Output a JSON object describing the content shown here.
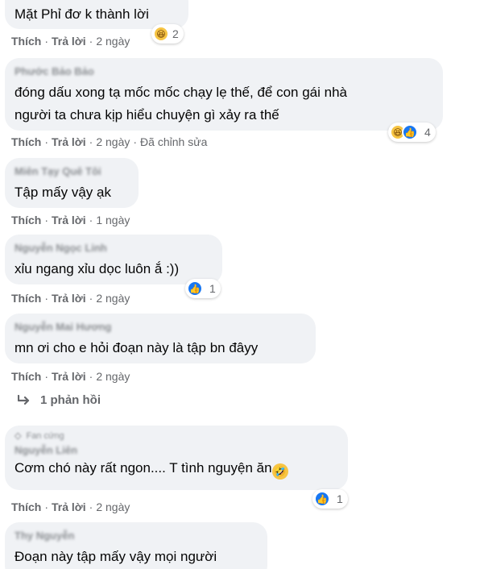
{
  "actions": {
    "like": "Thích",
    "reply": "Trả lời",
    "dot": "·"
  },
  "comments": [
    {
      "author": "",
      "text": "Mặt Phỉ đơ k thành lời",
      "time": "2 ngày",
      "edited": "",
      "reactions": {
        "icons": [
          "haha"
        ],
        "count": "2"
      }
    },
    {
      "author": "Phước Bảo Bảo",
      "text_line1": "đóng dấu xong tạ mốc mốc chạy lẹ thế, để con gái nhà",
      "text_line2": "người ta chưa kịp hiểu chuyện gì xảy ra thế",
      "time": "2 ngày",
      "edited": "Đã chỉnh sửa",
      "reactions": {
        "icons": [
          "haha",
          "like"
        ],
        "count": "4"
      }
    },
    {
      "author": "Miên Tạy Quê Tôi",
      "text": "Tập mấy vậy ạk",
      "time": "1 ngày"
    },
    {
      "author": "Nguyễn Ngọc Linh",
      "text": "xỉu ngang xỉu dọc luôn ắ :))",
      "time": "2 ngày",
      "reactions": {
        "icons": [
          "like"
        ],
        "count": "1"
      }
    },
    {
      "author": "Nguyễn Mai Hương",
      "text": "mn ơi cho e hỏi đoạn này là tập bn đâyy",
      "time": "2 ngày"
    },
    {
      "badge": "Fan cứng",
      "author": "Nguyễn Liên",
      "text": "Cơm chó này rất ngon.... T tình nguyện ăn",
      "time": "2 ngày",
      "reactions": {
        "icons": [
          "like"
        ],
        "count": "1"
      }
    },
    {
      "author": "Thy Nguyễn",
      "text": "Đoạn này tập mấy vậy mọi người"
    }
  ],
  "replies_link": {
    "label": "1 phản hồi",
    "icon": "reply-arrow-icon"
  },
  "colors": {
    "bubble": "#f0f2f5",
    "meta": "#65676b",
    "like_blue": "#1877f2",
    "haha_yellow": "#f7c544"
  }
}
